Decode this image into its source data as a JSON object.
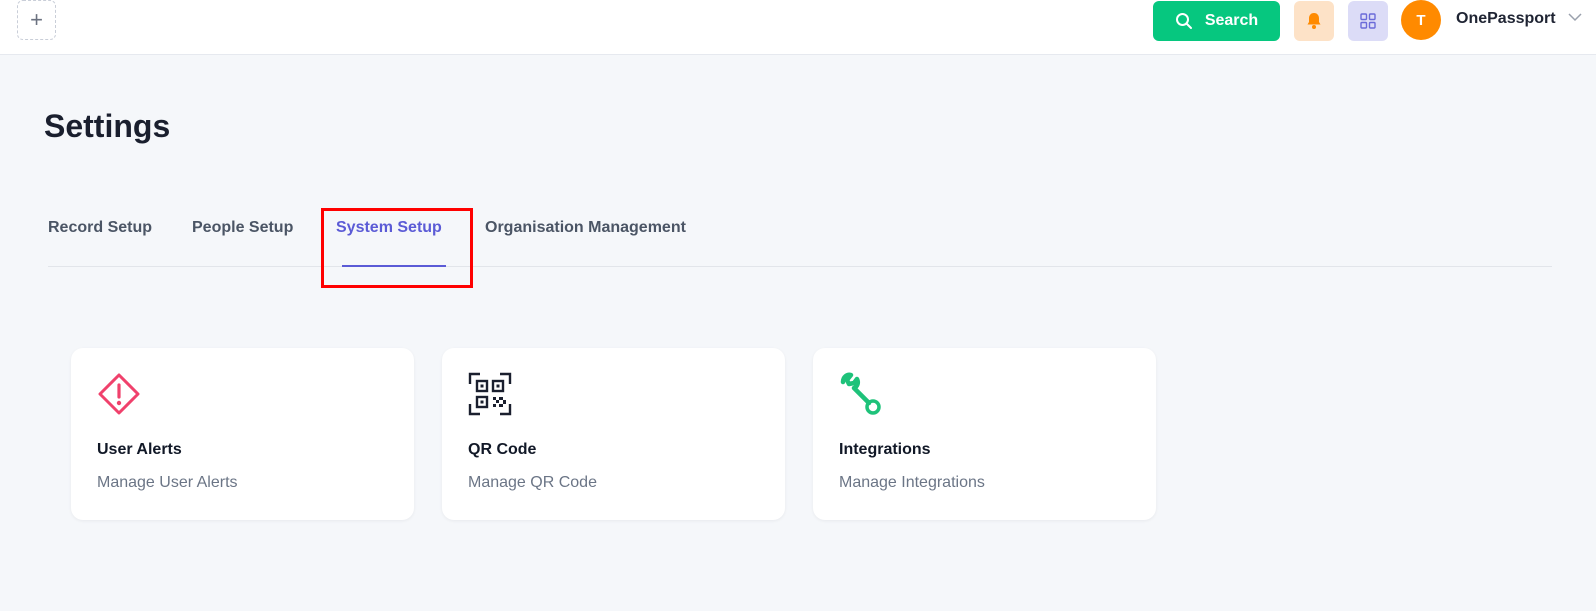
{
  "topbar": {
    "add_label": "+",
    "search_label": "Search",
    "avatar_initial": "T",
    "org_name": "OnePassport",
    "colors": {
      "search": "#06c77f",
      "bell_bg": "#fde2c7",
      "apps_bg": "#dcdcf7",
      "avatar": "#ff8a00"
    }
  },
  "page": {
    "title": "Settings"
  },
  "tabs": [
    {
      "label": "Record Setup",
      "active": false
    },
    {
      "label": "People Setup",
      "active": false
    },
    {
      "label": "System Setup",
      "active": true
    },
    {
      "label": "Organisation Management",
      "active": false
    }
  ],
  "cards": [
    {
      "icon": "alert-diamond-icon",
      "title": "User Alerts",
      "description": "Manage User Alerts",
      "icon_color": "#f0416c"
    },
    {
      "icon": "qr-code-icon",
      "title": "QR Code",
      "description": "Manage QR Code",
      "icon_color": "#1a1f2e"
    },
    {
      "icon": "wrench-icon",
      "title": "Integrations",
      "description": "Manage Integrations",
      "icon_color": "#1ec27a"
    }
  ],
  "accent": "#5b5bd6"
}
